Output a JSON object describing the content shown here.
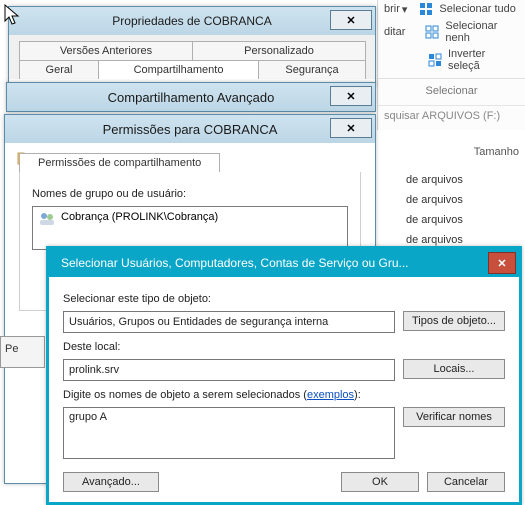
{
  "ribbon": {
    "open": "brir",
    "edit": "ditar",
    "select_all": "Selecionar tudo",
    "select_none": "Selecionar nenh",
    "invert": "Inverter seleçã",
    "group_label": "Selecionar",
    "search_placeholder": "squisar ARQUIVOS (F:)",
    "col_size": "Tamanho"
  },
  "file_rows": {
    "r1": "de arquivos",
    "r2": "de arquivos",
    "r3": "de arquivos",
    "r4": "de arquivos"
  },
  "props": {
    "title": "Propriedades de COBRANCA",
    "tab_prev": "Versões Anteriores",
    "tab_custom": "Personalizado",
    "tab_general": "Geral",
    "tab_share": "Compartilhamento",
    "tab_security": "Segurança"
  },
  "advshare": {
    "title": "Compartilhamento Avançado"
  },
  "perms": {
    "title": "Permissões para COBRANCA",
    "group_label": "Permissões de compartilhamento",
    "names_label": "Nomes de grupo ou de usuário:",
    "entry": "Cobrança (PROLINK\\Cobrança)",
    "pe_stub": "Pe"
  },
  "sel": {
    "title": "Selecionar Usuários, Computadores, Contas de Serviço ou Gru...",
    "type_label": "Selecionar este tipo de objeto:",
    "type_value": "Usuários, Grupos ou Entidades de segurança interna",
    "types_btn": "Tipos de objeto...",
    "loc_label": "Deste local:",
    "loc_value": "prolink.srv",
    "loc_btn": "Locais...",
    "names_label_a": "Digite os nomes de objeto a serem selecionados (",
    "names_label_link": "exemplos",
    "names_label_b": "):",
    "names_value": "grupo A",
    "check_btn": "Verificar nomes",
    "adv_btn": "Avançado...",
    "ok_btn": "OK",
    "cancel_btn": "Cancelar"
  }
}
